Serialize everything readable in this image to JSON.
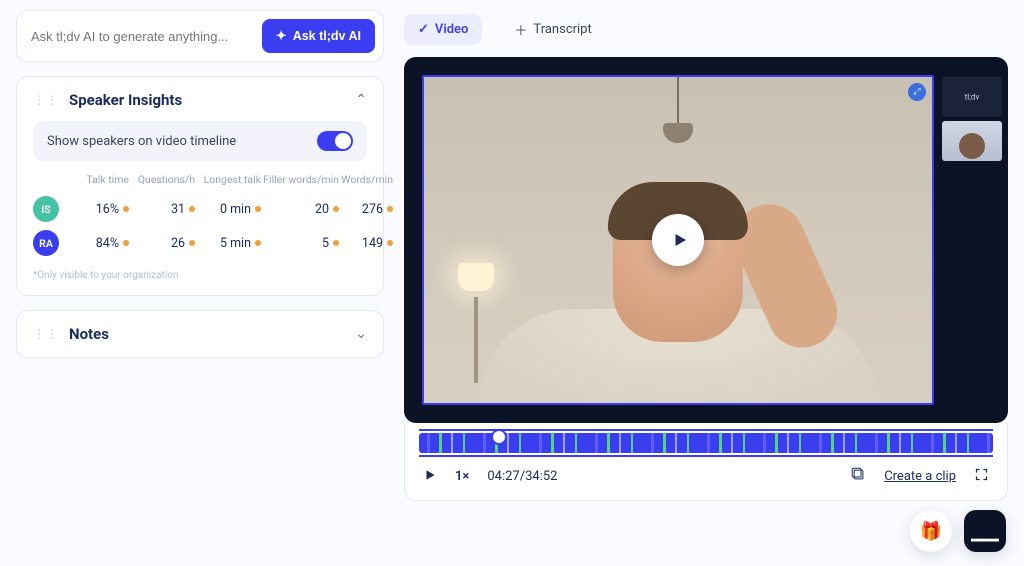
{
  "ask": {
    "placeholder": "Ask tl;dv AI to generate anything...",
    "button_label": "Ask tl;dv AI"
  },
  "insights": {
    "title": "Speaker Insights",
    "toggle_label": "Show speakers on video timeline",
    "columns": {
      "talk_time": "Talk time",
      "questions": "Questions/h",
      "longest_talk": "Longest talk",
      "filler": "Filler words/min",
      "words": "Words/min"
    },
    "rows": [
      {
        "initials": "IS",
        "avatar": "is",
        "talk_time": "16%",
        "questions": "31",
        "longest_talk": "0 min",
        "filler": "20",
        "words": "276"
      },
      {
        "initials": "RA",
        "avatar": "ra",
        "talk_time": "84%",
        "questions": "26",
        "longest_talk": "5 min",
        "filler": "5",
        "words": "149"
      }
    ],
    "footnote": "*Only visible to your organization"
  },
  "notes": {
    "title": "Notes"
  },
  "tabs": {
    "video": "Video",
    "transcript": "Transcript"
  },
  "player": {
    "speed": "1×",
    "current_time": "04:27",
    "total_time": "34:52",
    "clip_label": "Create a clip"
  }
}
